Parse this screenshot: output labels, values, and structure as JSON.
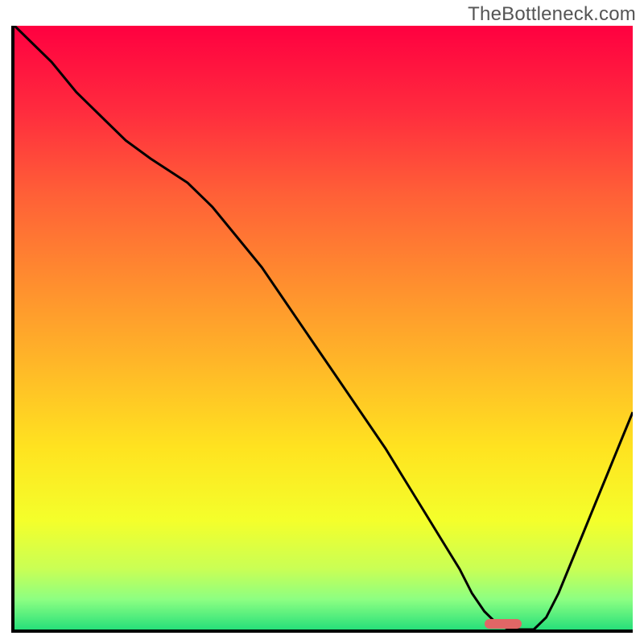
{
  "watermark": "TheBottleneck.com",
  "colors": {
    "axis": "#000000",
    "curve": "#000000",
    "marker": "#e06666",
    "gradient_stops": [
      {
        "offset": 0.0,
        "color": "#ff0040"
      },
      {
        "offset": 0.14,
        "color": "#ff2b3e"
      },
      {
        "offset": 0.28,
        "color": "#ff6037"
      },
      {
        "offset": 0.42,
        "color": "#ff8c2f"
      },
      {
        "offset": 0.56,
        "color": "#ffb728"
      },
      {
        "offset": 0.7,
        "color": "#ffe320"
      },
      {
        "offset": 0.82,
        "color": "#f4ff2b"
      },
      {
        "offset": 0.9,
        "color": "#c9ff55"
      },
      {
        "offset": 0.95,
        "color": "#8dff82"
      },
      {
        "offset": 1.0,
        "color": "#27e07a"
      }
    ]
  },
  "chart_data": {
    "type": "line",
    "title": "",
    "xlabel": "",
    "ylabel": "",
    "xlim": [
      0,
      100
    ],
    "ylim": [
      0,
      100
    ],
    "grid": false,
    "legend": false,
    "background": "vertical-gradient-red-to-green",
    "series": [
      {
        "name": "curve",
        "x": [
          0,
          3,
          6,
          10,
          14,
          18,
          22,
          25,
          28,
          32,
          36,
          40,
          44,
          48,
          52,
          56,
          60,
          63,
          66,
          69,
          72,
          74,
          76,
          78,
          80,
          82,
          84,
          86,
          88,
          90,
          92,
          94,
          96,
          98,
          100
        ],
        "y": [
          100,
          97,
          94,
          89,
          85,
          81,
          78,
          76,
          74,
          70,
          65,
          60,
          54,
          48,
          42,
          36,
          30,
          25,
          20,
          15,
          10,
          6,
          3,
          1,
          0,
          0,
          0,
          2,
          6,
          11,
          16,
          21,
          26,
          31,
          36
        ]
      }
    ],
    "marker": {
      "x_start": 76,
      "x_end": 82,
      "y": 1,
      "color": "#e06666"
    }
  }
}
